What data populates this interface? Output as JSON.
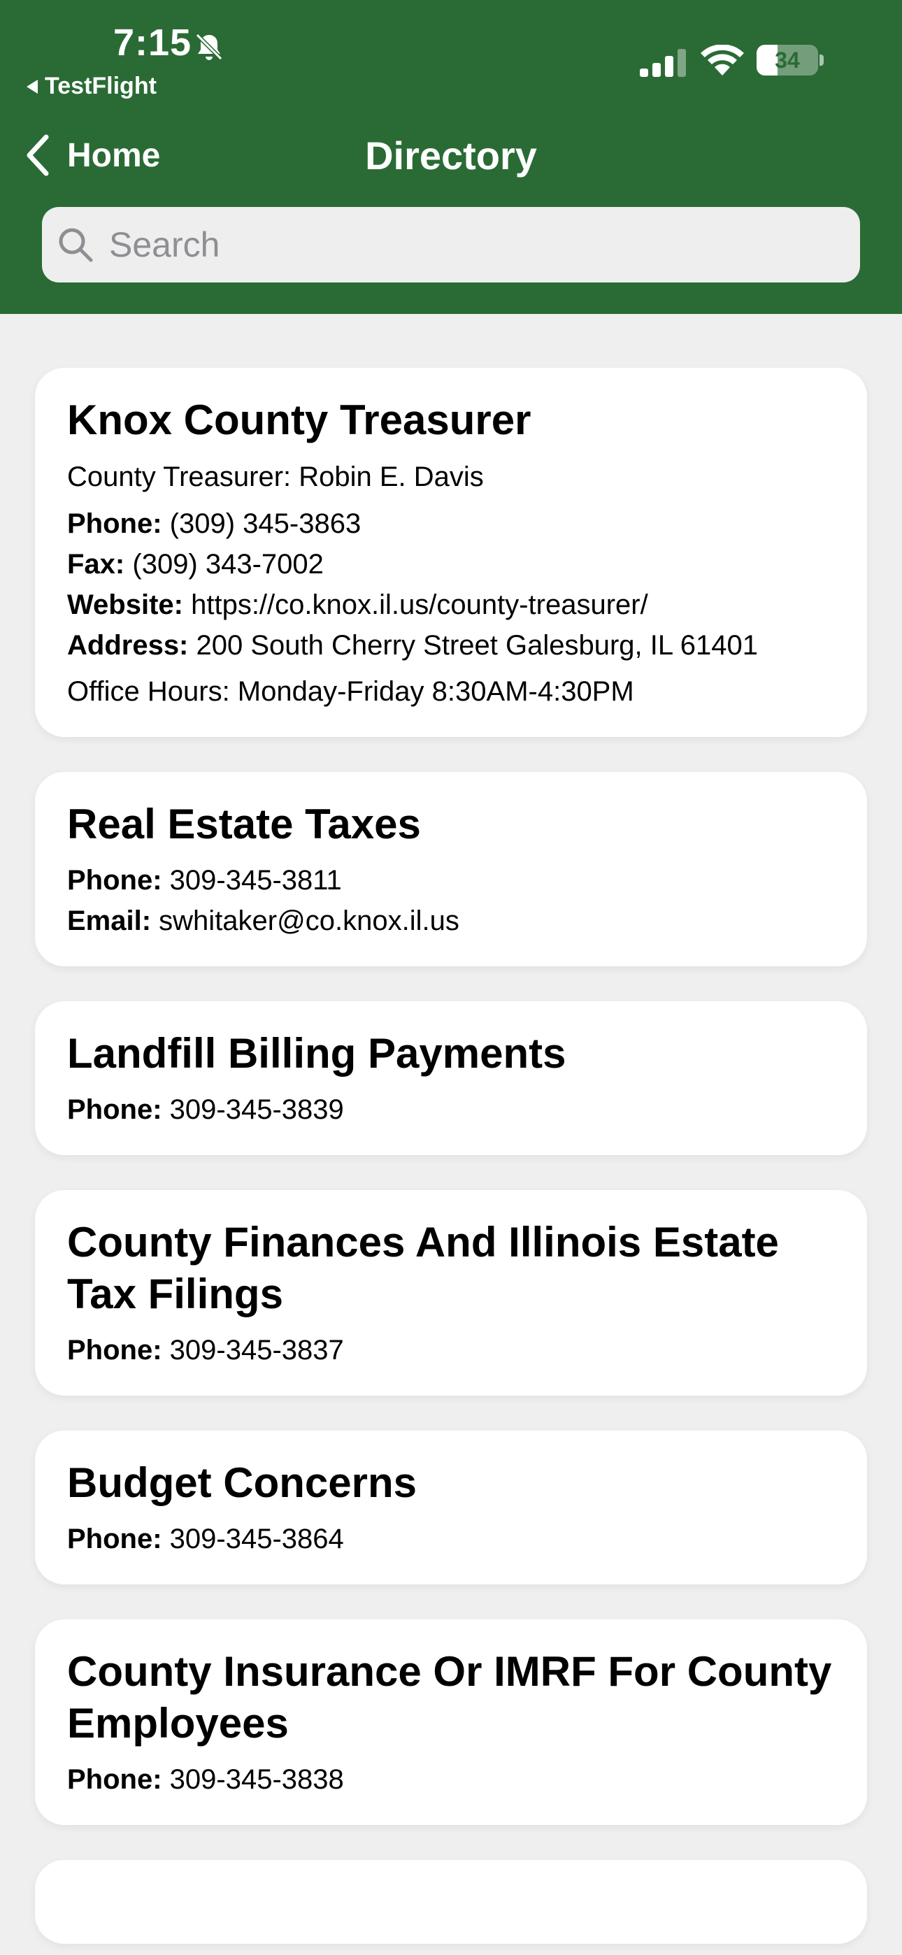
{
  "status": {
    "time": "7:15",
    "back_app": "TestFlight",
    "battery": "34",
    "battery_level": 0.34
  },
  "nav": {
    "back_label": "Home",
    "title": "Directory"
  },
  "search": {
    "placeholder": "Search",
    "value": ""
  },
  "cards": [
    {
      "title": "Knox County Treasurer",
      "subtitle": "County Treasurer: Robin E. Davis",
      "phone_label": "Phone:",
      "phone": "(309) 345-3863",
      "fax_label": "Fax:",
      "fax": "(309) 343-7002",
      "website_label": "Website:",
      "website": "https://co.knox.il.us/county-treasurer/",
      "address_label": "Address:",
      "address": "200 South Cherry Street Galesburg, IL  61401",
      "hours": "Office Hours:  Monday-Friday 8:30AM-4:30PM"
    },
    {
      "title": "Real Estate Taxes",
      "phone_label": "Phone:",
      "phone": "309-345-3811",
      "email_label": "Email:",
      "email": "swhitaker@co.knox.il.us"
    },
    {
      "title": "Landfill Billing Payments",
      "phone_label": "Phone:",
      "phone": "309-345-3839"
    },
    {
      "title": "County Finances And Illinois Estate Tax Filings",
      "phone_label": "Phone:",
      "phone": "309-345-3837"
    },
    {
      "title": "Budget Concerns",
      "phone_label": "Phone:",
      "phone": "309-345-3864"
    },
    {
      "title": "County Insurance Or IMRF For County Employees",
      "phone_label": "Phone:",
      "phone": "309-345-3838"
    }
  ]
}
